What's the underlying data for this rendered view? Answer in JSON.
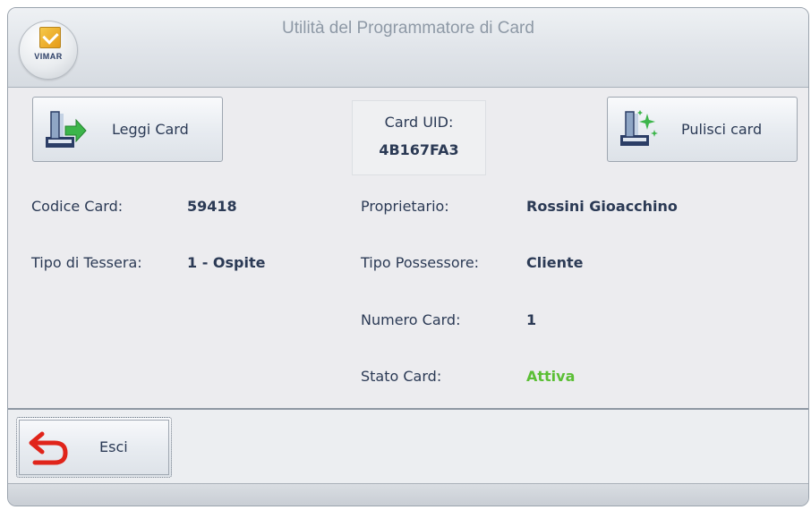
{
  "window": {
    "title": "Utilità del Programmatore di Card",
    "logo_text": "VIMAR"
  },
  "toolbar": {
    "read_label": "Leggi Card",
    "read_icon": "card-read-icon",
    "clear_label": "Pulisci card",
    "clear_icon": "card-clear-icon"
  },
  "card_uid": {
    "label": "Card UID:",
    "value": "4B167FA3"
  },
  "details_left": {
    "code_label": "Codice Card:",
    "code_value": "59418",
    "type_label": "Tipo di Tessera:",
    "type_value": "1 - Ospite"
  },
  "details_right": {
    "owner_label": "Proprietario:",
    "owner_value": "Rossini Gioacchino",
    "holder_type_label": "Tipo Possessore:",
    "holder_type_value": "Cliente",
    "number_label": "Numero Card:",
    "number_value": "1",
    "state_label": "Stato Card:",
    "state_value": "Attiva"
  },
  "footer": {
    "exit_label": "Esci",
    "exit_icon": "back-arrow-icon"
  },
  "colors": {
    "text": "#2b3a55",
    "active_state": "#5bbf35",
    "exit_arrow": "#e0241a",
    "read_arrow": "#3cb54a"
  }
}
